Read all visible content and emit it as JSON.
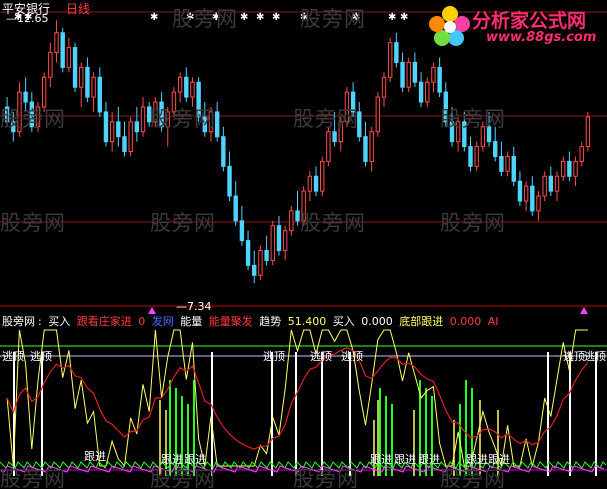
{
  "title": {
    "stock": "平安银行",
    "period": "日线",
    "high_marker": "12.65",
    "low_marker": "7.34"
  },
  "watermark": "股旁网",
  "logo": {
    "main": "分析家公式网",
    "url": "www.88gs.com"
  },
  "indicator_bar": {
    "name": "股旁网",
    "buy_label": "买入",
    "follow_label": "跟看庄家进",
    "follow_value": "0",
    "reach_label": "发网",
    "energy_label": "能量",
    "energy_value": "能量聚发",
    "trend_label": "趋势",
    "trend_value": "51.400",
    "buyin_label": "买入",
    "buyin_value": "0.000",
    "bottom_label": "底部跟进",
    "bottom_value": "0.000",
    "ai_label": "AI"
  },
  "signals": {
    "top_label": "逃顶",
    "follow_label": "跟进"
  },
  "colors": {
    "up": "#ff4a4a",
    "down": "#4fd4ff",
    "grid": "#c81e1e",
    "yellow": "#ffff66",
    "red_line": "#e02020",
    "green_bar": "#20ff20",
    "white_bar": "#ffffff",
    "magenta": "#ff40ff"
  },
  "chart_data": {
    "type": "candlestick",
    "title": "平安银行 日线",
    "ylim": [
      7.0,
      12.9
    ],
    "price_high": 12.65,
    "price_low": 7.34,
    "candles": [
      [
        10.9,
        11.1,
        10.5,
        10.6
      ],
      [
        10.6,
        10.8,
        10.2,
        10.4
      ],
      [
        10.4,
        11.4,
        10.3,
        11.2
      ],
      [
        11.2,
        11.5,
        10.8,
        11.0
      ],
      [
        11.0,
        11.2,
        10.4,
        10.5
      ],
      [
        10.5,
        11.0,
        10.4,
        10.9
      ],
      [
        10.9,
        11.6,
        10.8,
        11.5
      ],
      [
        11.5,
        12.2,
        11.3,
        12.0
      ],
      [
        12.0,
        12.65,
        11.8,
        12.4
      ],
      [
        12.4,
        12.5,
        11.6,
        11.7
      ],
      [
        11.7,
        12.3,
        11.6,
        12.1
      ],
      [
        12.1,
        12.2,
        11.2,
        11.3
      ],
      [
        11.3,
        11.8,
        10.9,
        11.7
      ],
      [
        11.7,
        11.9,
        11.0,
        11.1
      ],
      [
        11.1,
        11.6,
        10.8,
        11.5
      ],
      [
        11.5,
        11.7,
        10.7,
        10.8
      ],
      [
        10.8,
        11.0,
        10.1,
        10.2
      ],
      [
        10.2,
        10.8,
        10.0,
        10.6
      ],
      [
        10.6,
        10.9,
        10.1,
        10.3
      ],
      [
        10.3,
        10.6,
        9.9,
        10.0
      ],
      [
        10.0,
        10.7,
        9.9,
        10.6
      ],
      [
        10.6,
        10.9,
        10.2,
        10.4
      ],
      [
        10.4,
        11.1,
        10.3,
        10.9
      ],
      [
        10.9,
        11.0,
        10.5,
        10.6
      ],
      [
        10.6,
        11.1,
        10.5,
        11.0
      ],
      [
        11.0,
        11.2,
        10.4,
        10.5
      ],
      [
        10.5,
        10.9,
        10.1,
        10.8
      ],
      [
        10.8,
        11.3,
        10.7,
        11.2
      ],
      [
        11.2,
        11.6,
        11.0,
        11.5
      ],
      [
        11.5,
        11.7,
        11.0,
        11.1
      ],
      [
        11.1,
        11.5,
        10.9,
        11.4
      ],
      [
        11.4,
        11.5,
        10.6,
        10.7
      ],
      [
        10.7,
        11.0,
        10.3,
        10.4
      ],
      [
        10.4,
        10.9,
        10.2,
        10.8
      ],
      [
        10.8,
        11.0,
        10.2,
        10.3
      ],
      [
        10.3,
        10.5,
        9.6,
        9.7
      ],
      [
        9.7,
        10.0,
        9.0,
        9.1
      ],
      [
        9.1,
        9.4,
        8.5,
        8.6
      ],
      [
        8.6,
        8.9,
        8.1,
        8.2
      ],
      [
        8.2,
        8.4,
        7.6,
        7.7
      ],
      [
        7.7,
        8.0,
        7.34,
        7.5
      ],
      [
        7.5,
        8.1,
        7.4,
        8.0
      ],
      [
        8.0,
        8.3,
        7.7,
        7.8
      ],
      [
        7.8,
        8.6,
        7.7,
        8.5
      ],
      [
        8.5,
        8.7,
        7.9,
        8.0
      ],
      [
        8.0,
        8.5,
        7.8,
        8.4
      ],
      [
        8.4,
        8.9,
        8.3,
        8.8
      ],
      [
        8.8,
        9.2,
        8.5,
        8.6
      ],
      [
        8.6,
        9.3,
        8.5,
        9.2
      ],
      [
        9.2,
        9.6,
        9.0,
        9.5
      ],
      [
        9.5,
        9.7,
        9.1,
        9.2
      ],
      [
        9.2,
        9.9,
        9.1,
        9.8
      ],
      [
        9.8,
        10.5,
        9.7,
        10.4
      ],
      [
        10.4,
        10.8,
        10.1,
        10.2
      ],
      [
        10.2,
        10.7,
        10.0,
        10.6
      ],
      [
        10.6,
        11.3,
        10.5,
        11.2
      ],
      [
        11.2,
        11.4,
        10.7,
        10.8
      ],
      [
        10.8,
        11.0,
        10.2,
        10.3
      ],
      [
        10.3,
        10.6,
        9.7,
        9.8
      ],
      [
        9.8,
        10.5,
        9.6,
        10.4
      ],
      [
        10.4,
        11.2,
        10.3,
        11.1
      ],
      [
        11.1,
        11.6,
        10.9,
        11.5
      ],
      [
        11.5,
        12.3,
        11.4,
        12.2
      ],
      [
        12.2,
        12.4,
        11.7,
        11.8
      ],
      [
        11.8,
        12.0,
        11.2,
        11.3
      ],
      [
        11.3,
        11.9,
        11.2,
        11.8
      ],
      [
        11.8,
        12.0,
        11.3,
        11.4
      ],
      [
        11.4,
        11.6,
        10.9,
        11.0
      ],
      [
        11.0,
        11.5,
        10.9,
        11.4
      ],
      [
        11.4,
        11.8,
        11.2,
        11.7
      ],
      [
        11.7,
        11.9,
        11.1,
        11.2
      ],
      [
        11.2,
        11.4,
        10.5,
        10.6
      ],
      [
        10.6,
        10.9,
        10.1,
        10.2
      ],
      [
        10.2,
        10.7,
        10.0,
        10.6
      ],
      [
        10.6,
        10.8,
        10.0,
        10.1
      ],
      [
        10.1,
        10.3,
        9.6,
        9.7
      ],
      [
        9.7,
        10.2,
        9.6,
        10.1
      ],
      [
        10.1,
        10.6,
        10.0,
        10.5
      ],
      [
        10.5,
        10.8,
        10.1,
        10.2
      ],
      [
        10.2,
        10.5,
        9.8,
        9.9
      ],
      [
        9.9,
        10.2,
        9.5,
        9.6
      ],
      [
        9.6,
        10.0,
        9.5,
        9.9
      ],
      [
        9.9,
        10.1,
        9.3,
        9.4
      ],
      [
        9.4,
        9.6,
        8.9,
        9.0
      ],
      [
        9.0,
        9.4,
        8.8,
        9.3
      ],
      [
        9.3,
        9.5,
        8.7,
        8.8
      ],
      [
        8.8,
        9.2,
        8.6,
        9.1
      ],
      [
        9.1,
        9.6,
        9.0,
        9.5
      ],
      [
        9.5,
        9.7,
        9.1,
        9.2
      ],
      [
        9.2,
        9.6,
        9.0,
        9.5
      ],
      [
        9.5,
        9.9,
        9.4,
        9.8
      ],
      [
        9.8,
        10.0,
        9.4,
        9.5
      ],
      [
        9.5,
        9.9,
        9.3,
        9.8
      ],
      [
        9.8,
        10.2,
        9.7,
        10.1
      ],
      [
        10.1,
        10.8,
        10.0,
        10.7
      ]
    ]
  }
}
